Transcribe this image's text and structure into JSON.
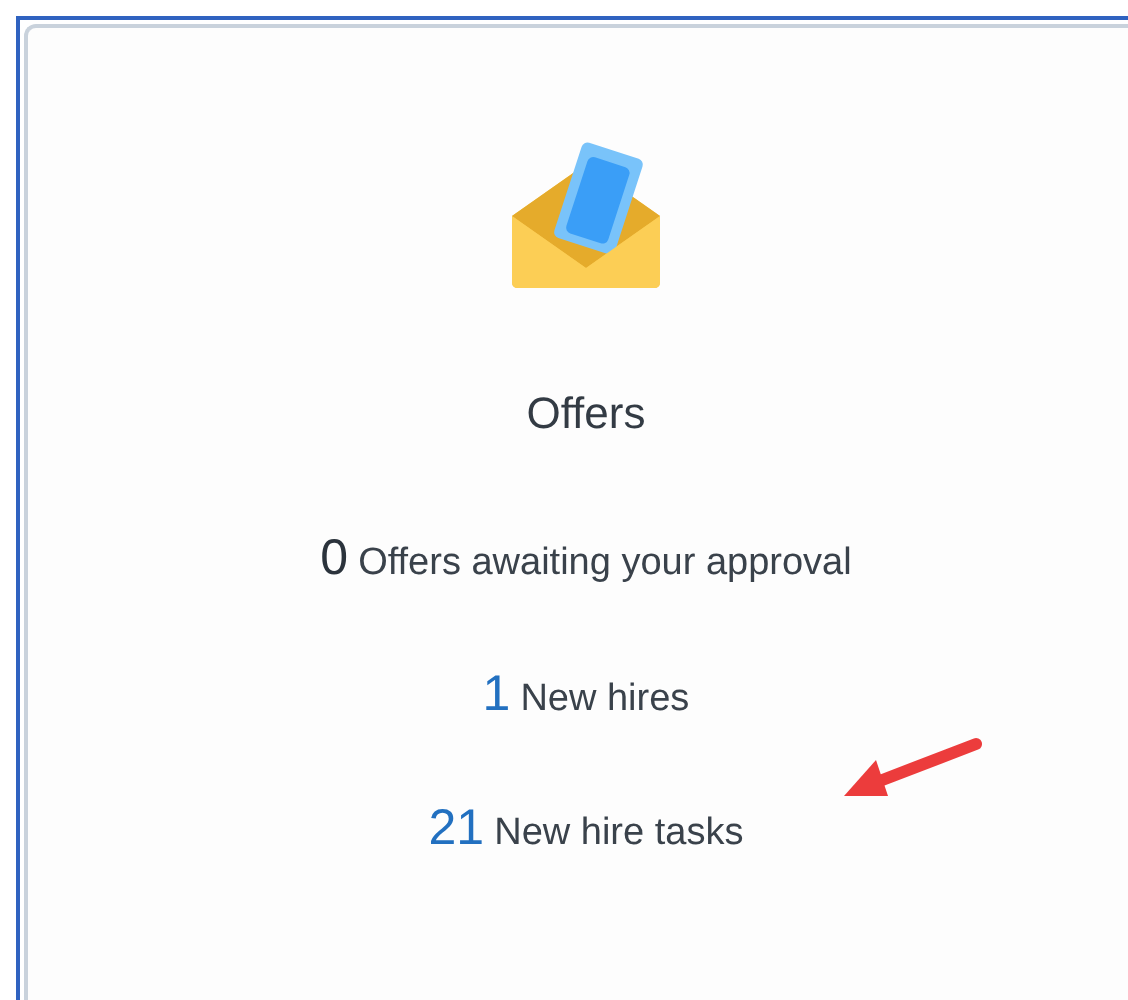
{
  "card": {
    "title": "Offers",
    "stats": [
      {
        "count": "0",
        "label": "Offers awaiting your approval",
        "linked": false
      },
      {
        "count": "1",
        "label": "New hires",
        "linked": true
      },
      {
        "count": "21",
        "label": "New hire tasks",
        "linked": true
      }
    ]
  }
}
